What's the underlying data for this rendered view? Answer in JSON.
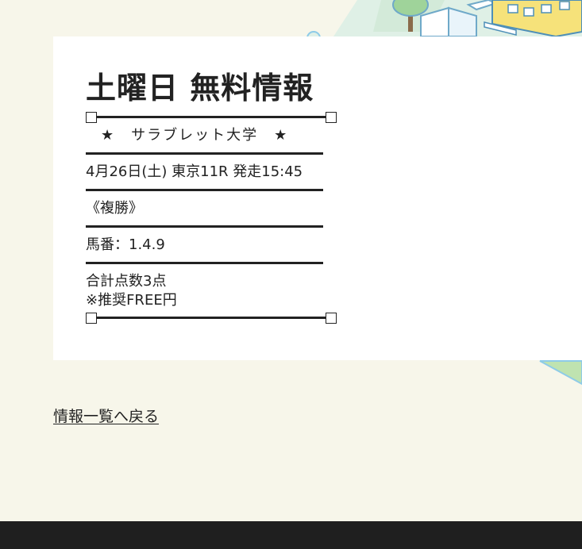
{
  "colors": {
    "page_bg": "#f7f6ea",
    "card_bg": "#ffffff",
    "text": "#222222",
    "footer_bg": "#1f1f1f",
    "deco_blue": "#8ecbe8",
    "deco_green": "#bfe3b0",
    "deco_yellow": "#f6e27a"
  },
  "article": {
    "title": "土曜日 無料情報",
    "stars_line": "★　サラブレット大学　★",
    "race_info": "4月26日(土) 東京11R 発走15:45",
    "bet_type": "《複勝》",
    "horse_numbers": "馬番：1.4.9",
    "total_points": "合計点数3点",
    "recommended": "※推奨FREE円"
  },
  "links": {
    "back": "情報一覧へ戻る"
  }
}
